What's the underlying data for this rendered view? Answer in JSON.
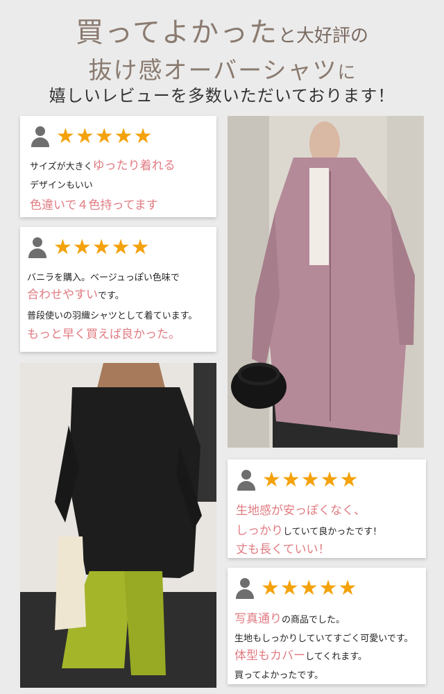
{
  "header": {
    "line1_big": "買ってよかった",
    "line1_small": "と大好評の",
    "line2_big": "抜け感オーバーシャツ",
    "line2_small": "に",
    "line3": "嬉しいレビューを多数いただいております！"
  },
  "rating_stars": "★★★★★",
  "reviews": [
    {
      "lines": [
        [
          {
            "t": "サイズが大きく",
            "p": false
          },
          {
            "t": "ゆったり着れる",
            "p": true
          }
        ],
        [
          {
            "t": "デザインもいい",
            "p": false
          }
        ],
        [
          {
            "t": "色違いで４色持ってます",
            "p": true
          }
        ]
      ]
    },
    {
      "lines": [
        [
          {
            "t": "バニラを購入。ベージュっぽい色味で",
            "p": false
          }
        ],
        [
          {
            "t": "合わせやすい",
            "p": true
          },
          {
            "t": "です。",
            "p": false
          }
        ],
        [
          {
            "t": "普段使いの羽織シャツとして着ています。",
            "p": false
          }
        ],
        [
          {
            "t": "もっと早く買えば良かった。",
            "p": true
          }
        ]
      ]
    },
    {
      "lines": [
        [
          {
            "t": "生地感が安っぽくなく、",
            "p": true
          }
        ],
        [
          {
            "t": "しっかり",
            "p": true
          },
          {
            "t": "していて良かったです！",
            "p": false
          }
        ],
        [
          {
            "t": "丈も長くていい！",
            "p": true
          }
        ]
      ]
    },
    {
      "lines": [
        [
          {
            "t": "写真通り",
            "p": true
          },
          {
            "t": "の商品でした。",
            "p": false
          }
        ],
        [
          {
            "t": "生地もしっかりしていてすごく可愛いです。",
            "p": false
          }
        ],
        [
          {
            "t": "体型もカバー",
            "p": true
          },
          {
            "t": "してくれます。",
            "p": false
          }
        ],
        [
          {
            "t": "買ってよかったです。",
            "p": false
          }
        ]
      ]
    }
  ],
  "colors": {
    "accent_pink": "#e07b82",
    "star": "#f4a20c",
    "heading": "#8a7a6f",
    "icon": "#6e6e6e"
  }
}
